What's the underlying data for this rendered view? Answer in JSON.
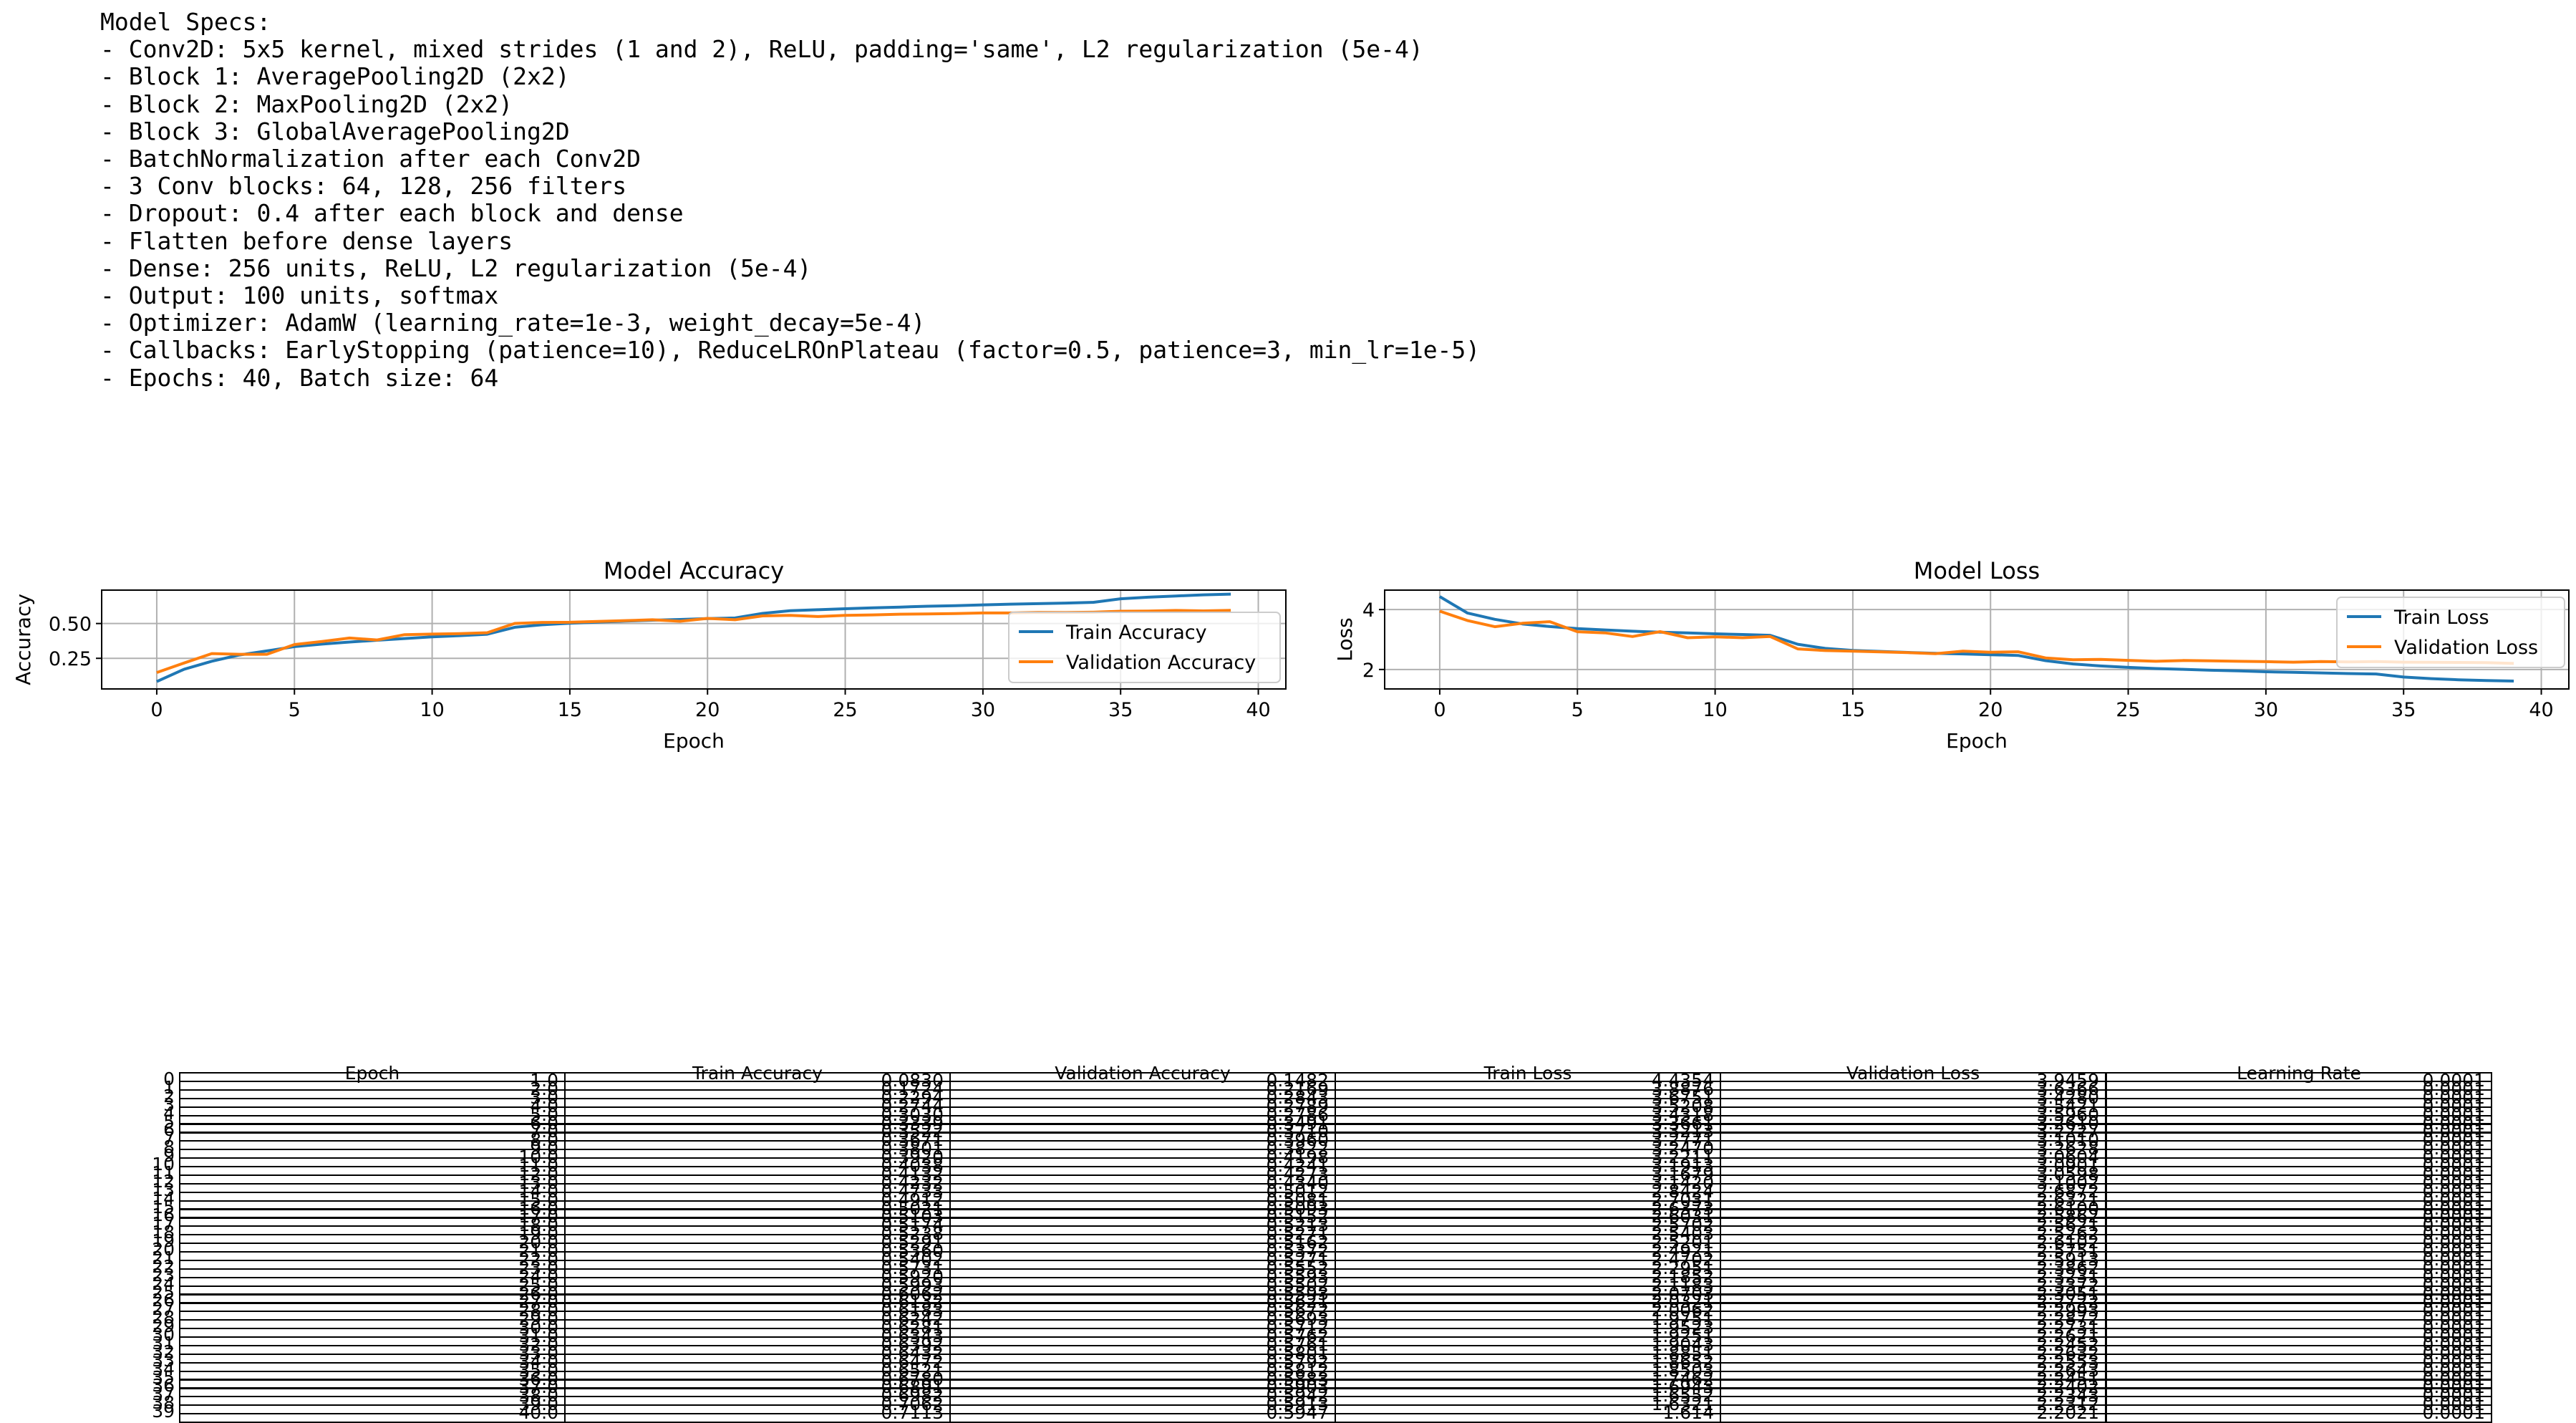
{
  "specs": {
    "lines": [
      "Model Specs:",
      "- Conv2D: 5x5 kernel, mixed strides (1 and 2), ReLU, padding='same', L2 regularization (5e-4)",
      "- Block 1: AveragePooling2D (2x2)",
      "- Block 2: MaxPooling2D (2x2)",
      "- Block 3: GlobalAveragePooling2D",
      "- BatchNormalization after each Conv2D",
      "- 3 Conv blocks: 64, 128, 256 filters",
      "- Dropout: 0.4 after each block and dense",
      "- Flatten before dense layers",
      "- Dense: 256 units, ReLU, L2 regularization (5e-4)",
      "- Output: 100 units, softmax",
      "- Optimizer: AdamW (learning_rate=1e-3, weight_decay=5e-4)",
      "- Callbacks: EarlyStopping (patience=10), ReduceLROnPlateau (factor=0.5, patience=3, min_lr=1e-5)",
      "- Epochs: 40, Batch size: 64"
    ]
  },
  "colors": {
    "train": "#1f77b4",
    "validation": "#ff7f0e",
    "grid": "#b0b0b0"
  },
  "chart_data": [
    {
      "type": "line",
      "title": "Model Accuracy",
      "xlabel": "Epoch",
      "ylabel": "Accuracy",
      "xlim": [
        -2,
        41
      ],
      "ylim": [
        0.03,
        0.74
      ],
      "xticks": [
        0,
        5,
        10,
        15,
        20,
        25,
        30,
        35,
        40
      ],
      "yticks": [
        0.25,
        0.5
      ],
      "ytick_labels": [
        "0.25",
        "0.50"
      ],
      "grid": true,
      "legend": "lower right",
      "x": [
        0,
        1,
        2,
        3,
        4,
        5,
        6,
        7,
        8,
        9,
        10,
        11,
        12,
        13,
        14,
        15,
        16,
        17,
        18,
        19,
        20,
        21,
        22,
        23,
        24,
        25,
        26,
        27,
        28,
        29,
        30,
        31,
        32,
        33,
        34,
        35,
        36,
        37,
        38,
        39
      ],
      "series": [
        {
          "name": "Train Accuracy",
          "color": "#1f77b4",
          "values": [
            0.083,
            0.172,
            0.229,
            0.274,
            0.303,
            0.334,
            0.352,
            0.367,
            0.38,
            0.392,
            0.404,
            0.413,
            0.423,
            0.473,
            0.491,
            0.502,
            0.51,
            0.517,
            0.524,
            0.529,
            0.536,
            0.54,
            0.573,
            0.592,
            0.599,
            0.606,
            0.613,
            0.618,
            0.624,
            0.628,
            0.634,
            0.639,
            0.643,
            0.647,
            0.652,
            0.678,
            0.689,
            0.698,
            0.706,
            0.711
          ]
        },
        {
          "name": "Validation Accuracy",
          "color": "#ff7f0e",
          "values": [
            0.148,
            0.217,
            0.284,
            0.279,
            0.279,
            0.349,
            0.371,
            0.396,
            0.382,
            0.42,
            0.424,
            0.427,
            0.434,
            0.501,
            0.508,
            0.509,
            0.515,
            0.521,
            0.527,
            0.516,
            0.537,
            0.527,
            0.555,
            0.559,
            0.55,
            0.559,
            0.562,
            0.567,
            0.569,
            0.571,
            0.576,
            0.576,
            0.58,
            0.579,
            0.581,
            0.588,
            0.59,
            0.594,
            0.591,
            0.595
          ]
        }
      ]
    },
    {
      "type": "line",
      "title": "Model Loss",
      "xlabel": "Epoch",
      "ylabel": "Loss",
      "xlim": [
        -2,
        41
      ],
      "ylim": [
        1.35,
        4.65
      ],
      "xticks": [
        0,
        5,
        10,
        15,
        20,
        25,
        30,
        35,
        40
      ],
      "yticks": [
        2,
        4
      ],
      "ytick_labels": [
        "2",
        "4"
      ],
      "grid": true,
      "legend": "upper right",
      "x": [
        0,
        1,
        2,
        3,
        4,
        5,
        6,
        7,
        8,
        9,
        10,
        11,
        12,
        13,
        14,
        15,
        16,
        17,
        18,
        19,
        20,
        21,
        22,
        23,
        24,
        25,
        26,
        27,
        28,
        29,
        30,
        31,
        32,
        33,
        34,
        35,
        36,
        37,
        38,
        39
      ],
      "series": [
        {
          "name": "Train Loss",
          "color": "#1f77b4",
          "values": [
            4.435,
            3.888,
            3.675,
            3.521,
            3.432,
            3.366,
            3.321,
            3.277,
            3.247,
            3.221,
            3.191,
            3.168,
            3.142,
            2.842,
            2.703,
            2.637,
            2.603,
            2.57,
            2.54,
            2.52,
            2.492,
            2.47,
            2.295,
            2.185,
            2.118,
            2.07,
            2.032,
            2.006,
            1.975,
            1.952,
            1.925,
            1.904,
            1.885,
            1.865,
            1.85,
            1.746,
            1.694,
            1.655,
            1.632,
            1.614
          ]
        },
        {
          "name": "Validation Loss",
          "color": "#ff7f0e",
          "values": [
            3.946,
            3.637,
            3.428,
            3.542,
            3.596,
            3.261,
            3.223,
            3.101,
            3.263,
            3.06,
            3.09,
            3.06,
            3.1,
            2.687,
            2.632,
            2.61,
            2.586,
            2.562,
            2.526,
            2.61,
            2.575,
            2.591,
            2.386,
            2.323,
            2.337,
            2.305,
            2.272,
            2.299,
            2.287,
            2.273,
            2.262,
            2.245,
            2.263,
            2.255,
            2.264,
            2.245,
            2.24,
            2.234,
            2.231,
            2.202
          ]
        }
      ]
    },
    {
      "type": "table",
      "columns": [
        "Epoch",
        "Train Accuracy",
        "Validation Accuracy",
        "Train Loss",
        "Validation Loss",
        "Learning Rate"
      ],
      "rows": [
        [
          "0",
          "1.0",
          "0.0830",
          "0.1482",
          "4.4354",
          "3.9459",
          "0.0001"
        ],
        [
          "1",
          "2.0",
          "0.1724",
          "0.2169",
          "3.8876",
          "3.6366",
          "0.0001"
        ],
        [
          "2",
          "3.0",
          "0.2294",
          "0.2843",
          "3.6751",
          "3.4280",
          "0.0001"
        ],
        [
          "3",
          "4.0",
          "0.2744",
          "0.2789",
          "3.5208",
          "3.5421",
          "0.0001"
        ],
        [
          "4",
          "5.0",
          "0.3030",
          "0.2786",
          "3.4318",
          "3.5960",
          "0.0001"
        ],
        [
          "5",
          "6.0",
          "0.3339",
          "0.3491",
          "3.3661",
          "3.2610",
          "0.0001"
        ],
        [
          "6",
          "7.0",
          "0.3522",
          "0.3710",
          "3.3213",
          "3.2227",
          "0.0001"
        ],
        [
          "7",
          "8.0",
          "0.3671",
          "0.3960",
          "3.2771",
          "3.1010",
          "0.0001"
        ],
        [
          "8",
          "9.0",
          "0.3801",
          "0.3822",
          "3.2470",
          "3.2628",
          "0.0001"
        ],
        [
          "9",
          "10.0",
          "0.3920",
          "0.4198",
          "3.2211",
          "3.0604",
          "0.0001"
        ],
        [
          "10",
          "11.0",
          "0.4038",
          "0.4241",
          "3.1913",
          "3.0901",
          "0.0001"
        ],
        [
          "11",
          "12.0",
          "0.4132",
          "0.4273",
          "3.1679",
          "3.0598",
          "0.0001"
        ],
        [
          "12",
          "13.0",
          "0.4232",
          "0.4340",
          "3.1420",
          "3.1002",
          "0.0001"
        ],
        [
          "13",
          "14.0",
          "0.4733",
          "0.5012",
          "2.8424",
          "2.6872",
          "0.0001"
        ],
        [
          "14",
          "15.0",
          "0.4912",
          "0.5081",
          "2.7031",
          "2.6321",
          "0.0001"
        ],
        [
          "15",
          "16.0",
          "0.5021",
          "0.5093",
          "2.6373",
          "2.6100",
          "0.0001"
        ],
        [
          "16",
          "17.0",
          "0.5103",
          "0.5152",
          "2.6031",
          "2.5862",
          "0.0001"
        ],
        [
          "17",
          "18.0",
          "0.5174",
          "0.5213",
          "2.5702",
          "2.5621",
          "0.0001"
        ],
        [
          "18",
          "19.0",
          "0.5238",
          "0.5271",
          "2.5403",
          "2.5262",
          "0.0001"
        ],
        [
          "19",
          "20.0",
          "0.5291",
          "0.5162",
          "2.5201",
          "2.6102",
          "0.0001"
        ],
        [
          "20",
          "21.0",
          "0.5360",
          "0.5372",
          "2.4921",
          "2.5751",
          "0.0001"
        ],
        [
          "21",
          "22.0",
          "0.5402",
          "0.5271",
          "2.4702",
          "2.5913",
          "0.0001"
        ],
        [
          "22",
          "23.0",
          "0.5731",
          "0.5552",
          "2.2951",
          "2.3862",
          "0.0001"
        ],
        [
          "23",
          "24.0",
          "0.5920",
          "0.5593",
          "2.1852",
          "2.3231",
          "0.0001"
        ],
        [
          "24",
          "25.0",
          "0.5993",
          "0.5502",
          "2.1183",
          "2.3372",
          "0.0001"
        ],
        [
          "25",
          "26.0",
          "0.6062",
          "0.5593",
          "2.0703",
          "2.3051",
          "0.0001"
        ],
        [
          "26",
          "27.0",
          "0.6132",
          "0.5621",
          "2.0321",
          "2.2722",
          "0.0001"
        ],
        [
          "27",
          "28.0",
          "0.6183",
          "0.5672",
          "2.0062",
          "2.2993",
          "0.0001"
        ],
        [
          "28",
          "29.0",
          "0.6242",
          "0.5693",
          "1.9751",
          "2.2872",
          "0.0001"
        ],
        [
          "29",
          "30.0",
          "0.6281",
          "0.5712",
          "1.9523",
          "2.2731",
          "0.0001"
        ],
        [
          "30",
          "31.0",
          "0.6343",
          "0.5762",
          "1.9251",
          "2.2621",
          "0.0001"
        ],
        [
          "31",
          "32.0",
          "0.6392",
          "0.5761",
          "1.9043",
          "2.2452",
          "0.0001"
        ],
        [
          "32",
          "33.0",
          "0.6432",
          "0.5801",
          "1.8851",
          "2.2632",
          "0.0001"
        ],
        [
          "33",
          "34.0",
          "0.6472",
          "0.5792",
          "1.8652",
          "2.2553",
          "0.0001"
        ],
        [
          "34",
          "35.0",
          "0.6521",
          "0.5812",
          "1.8503",
          "2.2643",
          "0.0001"
        ],
        [
          "35",
          "36.0",
          "0.6780",
          "0.5883",
          "1.7462",
          "2.2451",
          "0.0001"
        ],
        [
          "36",
          "37.0",
          "0.6891",
          "0.5903",
          "1.6943",
          "2.2402",
          "0.0001"
        ],
        [
          "37",
          "38.0",
          "0.6982",
          "0.5942",
          "1.6552",
          "2.2343",
          "0.0001"
        ],
        [
          "38",
          "39.0",
          "0.7062",
          "0.5913",
          "1.6321",
          "2.2312",
          "0.0001"
        ],
        [
          "39",
          "40.0",
          "0.7113",
          "0.5947",
          "1.614",
          "2.2021",
          "0.0001"
        ]
      ]
    }
  ]
}
